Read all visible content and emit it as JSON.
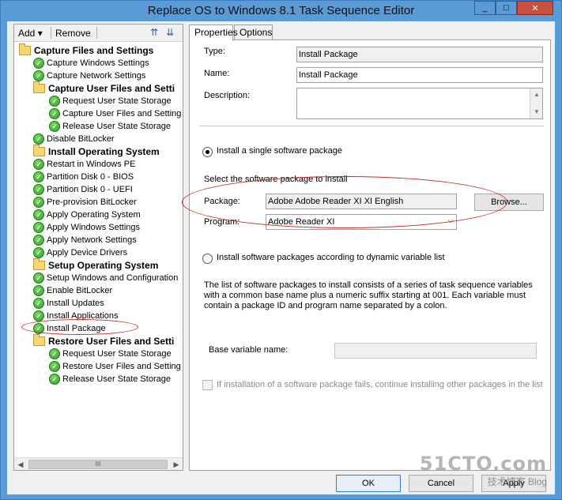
{
  "window": {
    "title": "Replace OS to Windows 8.1 Task Sequence Editor",
    "minimize_glyph": "_",
    "maximize_glyph": "□",
    "close_glyph": "✕"
  },
  "toolbar": {
    "add_label": "Add",
    "add_arrow": "▾",
    "remove_label": "Remove"
  },
  "tree": {
    "items": [
      {
        "label": "Capture Files and Settings",
        "kind": "group"
      },
      {
        "label": "Capture Windows Settings",
        "kind": "step"
      },
      {
        "label": "Capture Network Settings",
        "kind": "step"
      },
      {
        "label": "Capture User Files and Setti",
        "kind": "group"
      },
      {
        "label": "Request User State Storage",
        "kind": "step"
      },
      {
        "label": "Capture User Files and Setting",
        "kind": "step"
      },
      {
        "label": "Release User State Storage",
        "kind": "step"
      },
      {
        "label": "Disable BitLocker",
        "kind": "step"
      },
      {
        "label": "Install Operating System",
        "kind": "group"
      },
      {
        "label": "Restart in Windows PE",
        "kind": "step"
      },
      {
        "label": "Partition Disk 0 - BIOS",
        "kind": "step"
      },
      {
        "label": "Partition Disk 0 - UEFI",
        "kind": "step"
      },
      {
        "label": "Pre-provision BitLocker",
        "kind": "step"
      },
      {
        "label": "Apply Operating System",
        "kind": "step"
      },
      {
        "label": "Apply Windows Settings",
        "kind": "step"
      },
      {
        "label": "Apply Network Settings",
        "kind": "step"
      },
      {
        "label": "Apply Device Drivers",
        "kind": "step"
      },
      {
        "label": "Setup Operating System",
        "kind": "group"
      },
      {
        "label": "Setup Windows and Configuration",
        "kind": "step"
      },
      {
        "label": "Enable BitLocker",
        "kind": "step"
      },
      {
        "label": "Install Updates",
        "kind": "step"
      },
      {
        "label": "Install Applications",
        "kind": "step"
      },
      {
        "label": "Install Package",
        "kind": "step"
      },
      {
        "label": "Restore User Files and Setti",
        "kind": "group"
      },
      {
        "label": "Request User State Storage",
        "kind": "step"
      },
      {
        "label": "Restore User Files and Setting",
        "kind": "step"
      },
      {
        "label": "Release User State Storage",
        "kind": "step"
      }
    ]
  },
  "scrollbar": {
    "grip": "III",
    "left_arrow": "◀",
    "right_arrow": "▶"
  },
  "tabs": {
    "properties": "Properties",
    "options": "Options"
  },
  "props": {
    "type_label": "Type:",
    "type_value": "Install Package",
    "name_label": "Name:",
    "name_value": "Install Package",
    "description_label": "Description:",
    "description_value": "",
    "radio_single_label": "Install a single software package",
    "select_package_label": "Select the software package to install",
    "package_label": "Package:",
    "package_value": "Adobe Adobe Reader XI XI English",
    "browse_label": "Browse...",
    "program_label": "Program:",
    "program_value": "Adobe Reader XI",
    "radio_dynamic_label": "Install software packages according to dynamic variable list",
    "dynamic_desc": "The list of software packages to install consists of a series of task sequence variables with a common base name plus a numeric suffix starting at 001.  Each variable must contain a package ID and program name separated by a colon.",
    "base_var_label": "Base variable name:",
    "base_var_value": "",
    "continue_label": "If installation of a software package fails, continue installing other packages in the list"
  },
  "footer": {
    "ok_label": "OK",
    "cancel_label": "Cancel",
    "apply_label": "Apply"
  },
  "watermark": {
    "main": "51CTO.com",
    "sub": "技术博客  Blog"
  },
  "colors": {
    "accent_title": "#5a9bd5",
    "annotation_red": "#c0302a",
    "check_green": "#2e9a23"
  }
}
